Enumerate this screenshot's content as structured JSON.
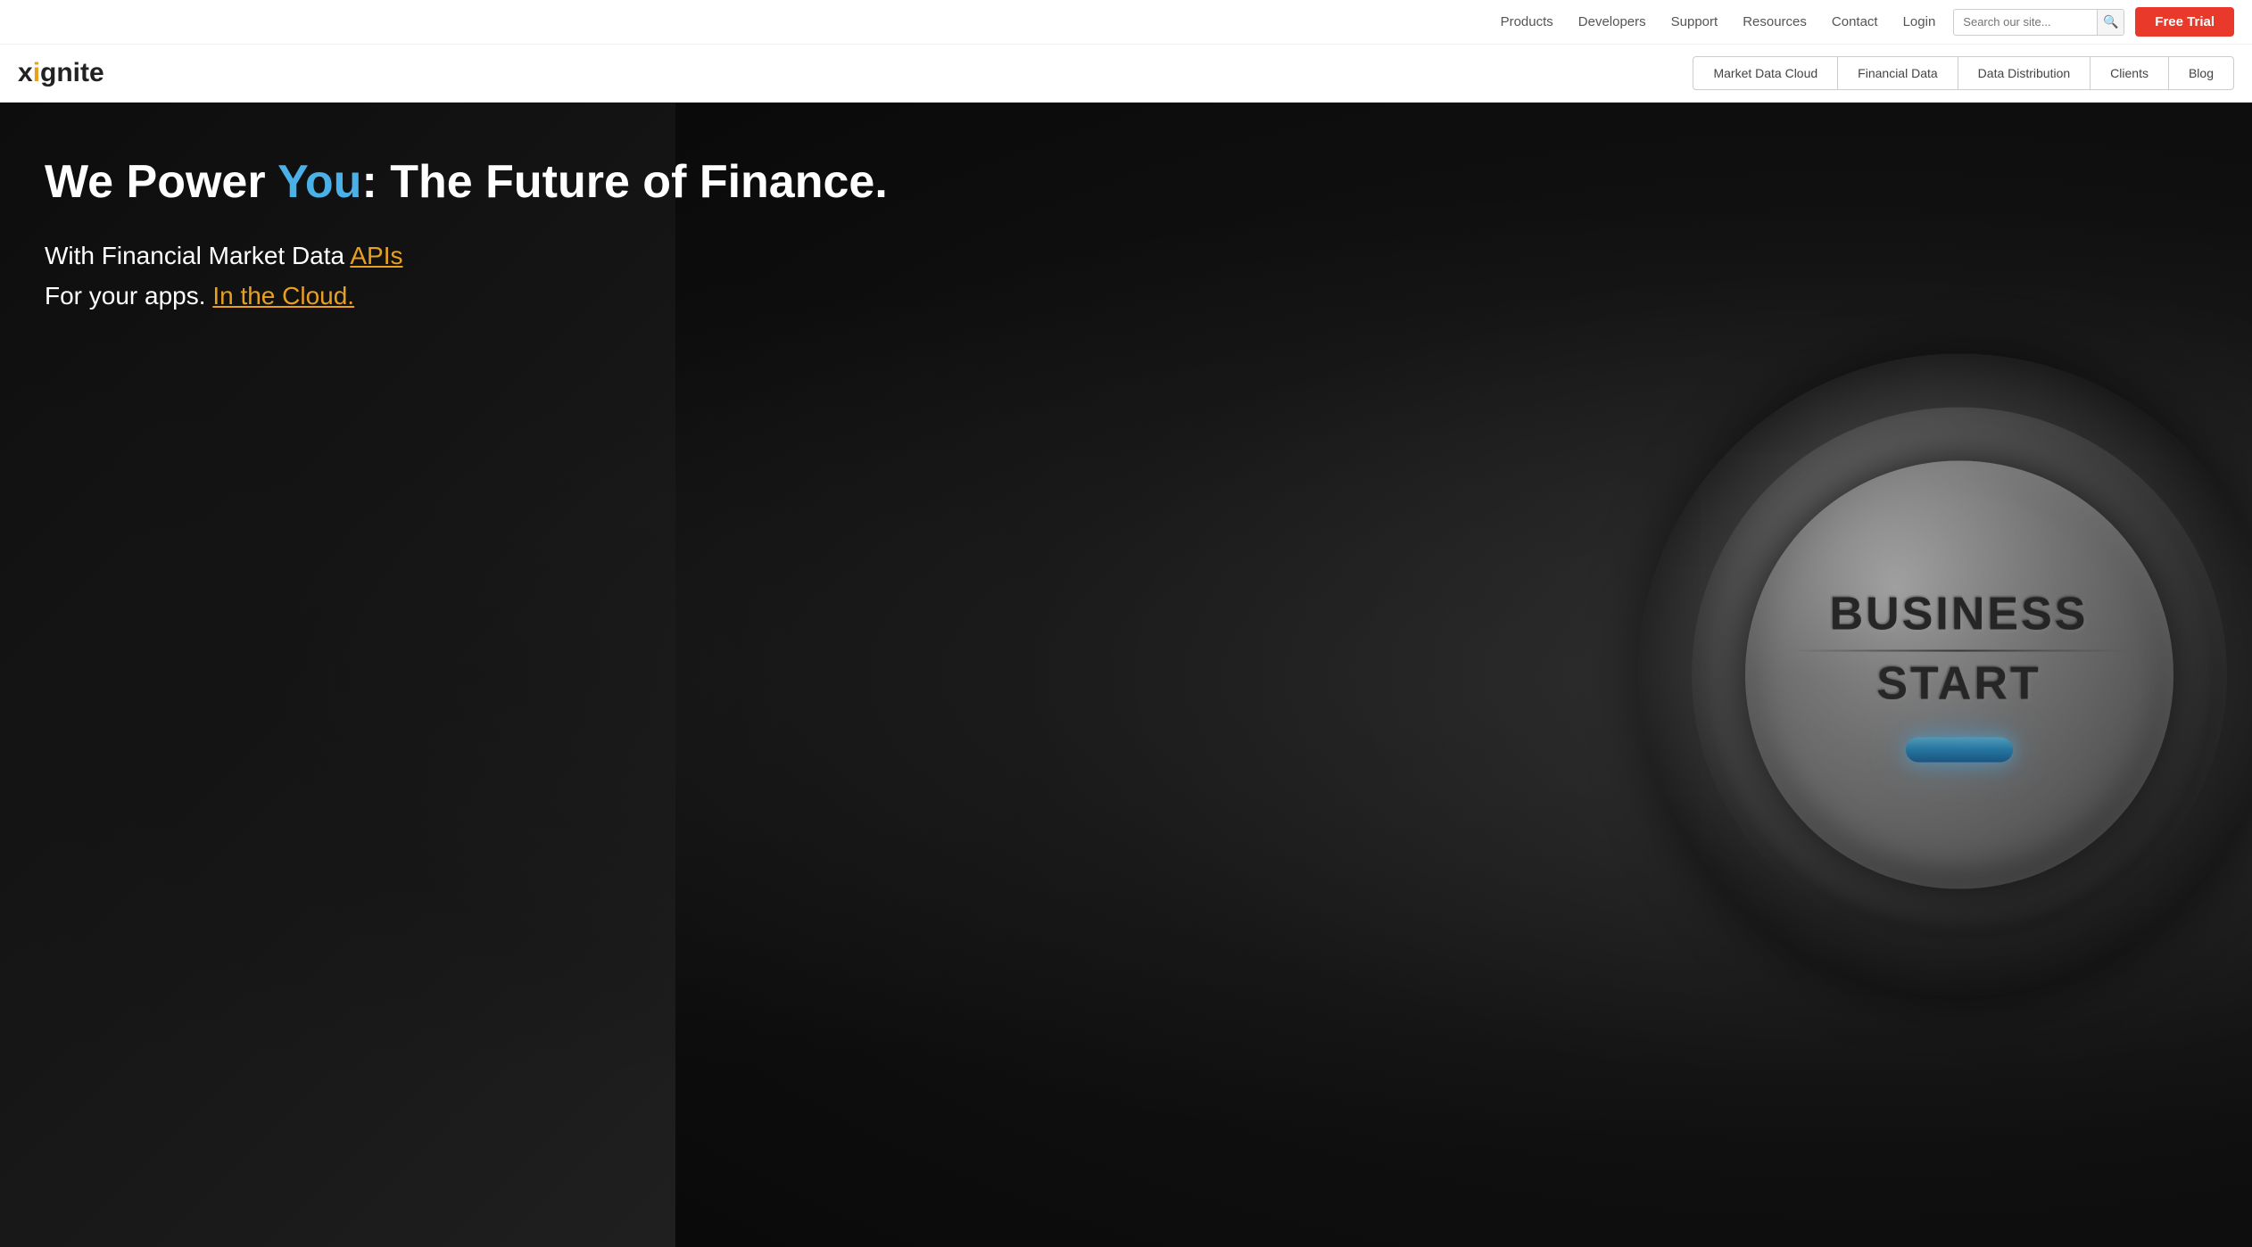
{
  "topNav": {
    "links": [
      {
        "label": "Products",
        "href": "#"
      },
      {
        "label": "Developers",
        "href": "#"
      },
      {
        "label": "Support",
        "href": "#"
      },
      {
        "label": "Resources",
        "href": "#"
      },
      {
        "label": "Contact",
        "href": "#"
      },
      {
        "label": "Login",
        "href": "#"
      }
    ],
    "search": {
      "placeholder": "Search our site...",
      "value": ""
    },
    "freeTrial": {
      "label": "Free Trial"
    }
  },
  "secondaryNav": {
    "logo": {
      "text": "xignite",
      "prefix": "x",
      "dot": "i",
      "suffix": "gnite"
    },
    "links": [
      {
        "label": "Market Data Cloud",
        "href": "#"
      },
      {
        "label": "Financial Data",
        "href": "#"
      },
      {
        "label": "Data Distribution",
        "href": "#"
      },
      {
        "label": "Clients",
        "href": "#"
      },
      {
        "label": "Blog",
        "href": "#"
      }
    ]
  },
  "hero": {
    "title": {
      "prefix": "We Power ",
      "highlight": "You",
      "suffix": ": The Future of Finance."
    },
    "subtitle": {
      "line1_prefix": "With Financial Market Data ",
      "line1_link": "APIs",
      "line2_prefix": "For your apps. ",
      "line2_link": "In the Cloud."
    },
    "button": {
      "line1": "BUSINESS",
      "line2": "START"
    }
  }
}
